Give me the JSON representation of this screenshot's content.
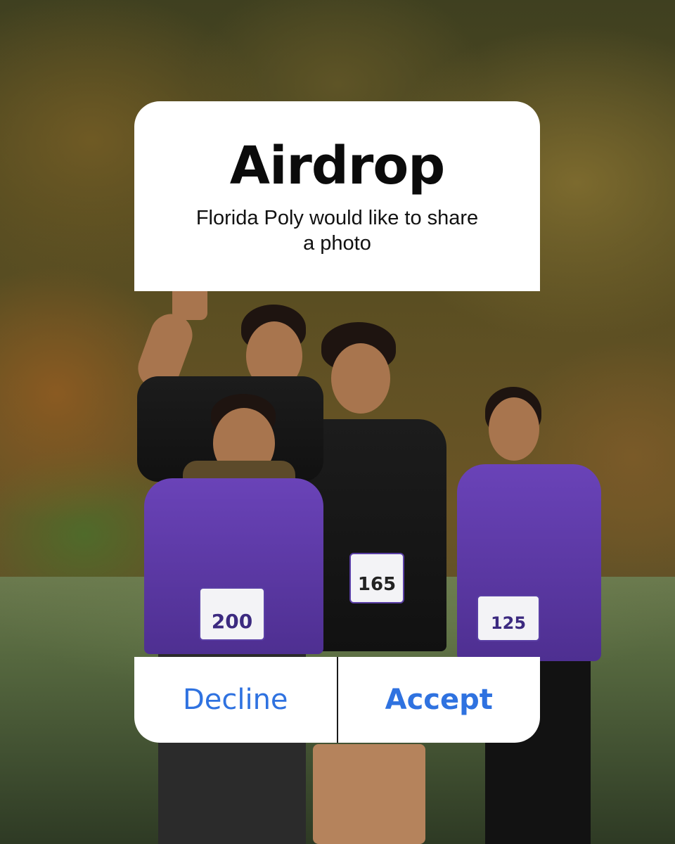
{
  "dialog": {
    "title": "Airdrop",
    "message": "Florida Poly would like to share a photo",
    "decline_label": "Decline",
    "accept_label": "Accept"
  },
  "photo": {
    "bibs": [
      "200",
      "165",
      "125"
    ]
  },
  "colors": {
    "button_text": "#2f72e0",
    "dialog_background": "#ffffff",
    "title_text": "#0b0b0b"
  }
}
